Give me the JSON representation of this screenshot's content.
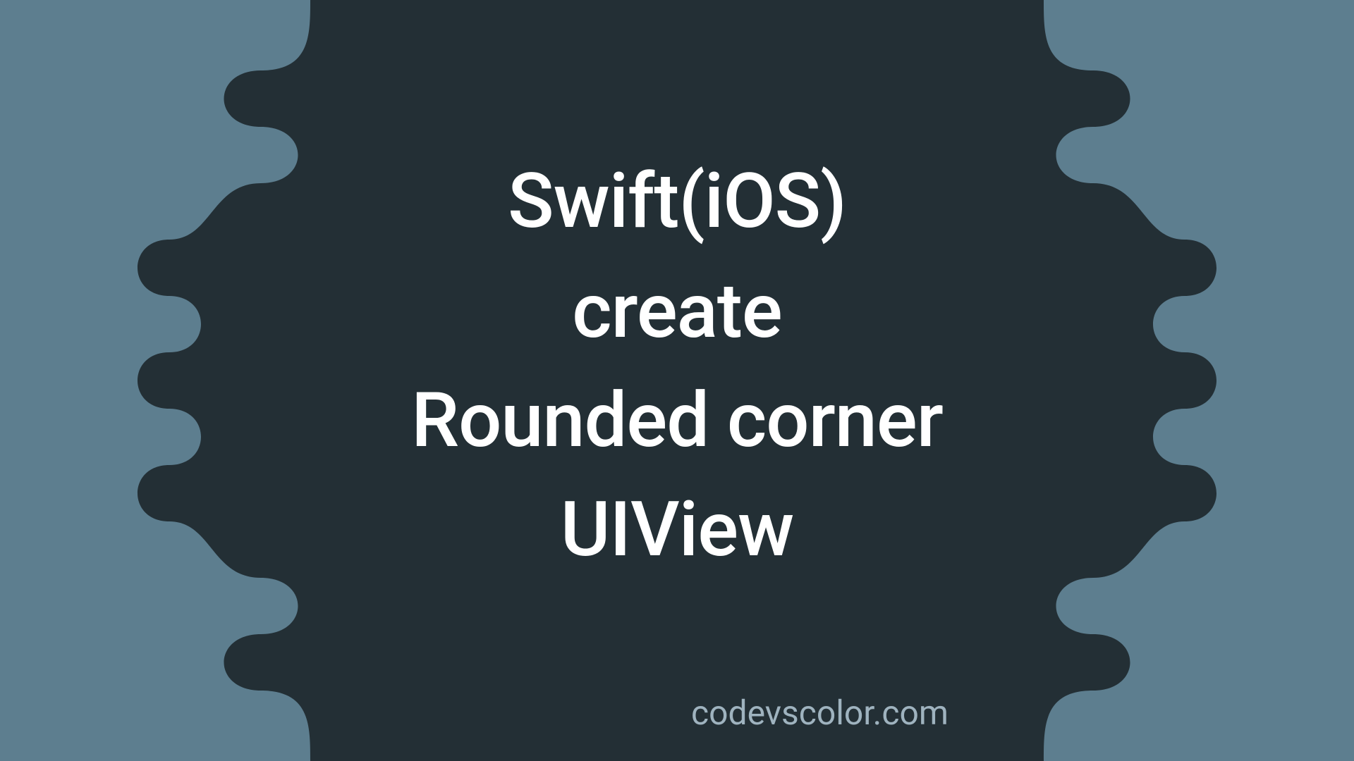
{
  "title": {
    "line1": "Swift(iOS)",
    "line2": "create",
    "line3": "Rounded corner",
    "line4": "UIView"
  },
  "footer": "codevscolor.com",
  "colors": {
    "background": "#5d7e8f",
    "blob": "#232f35",
    "titleText": "#ffffff",
    "footerText": "#9fb3bf"
  }
}
